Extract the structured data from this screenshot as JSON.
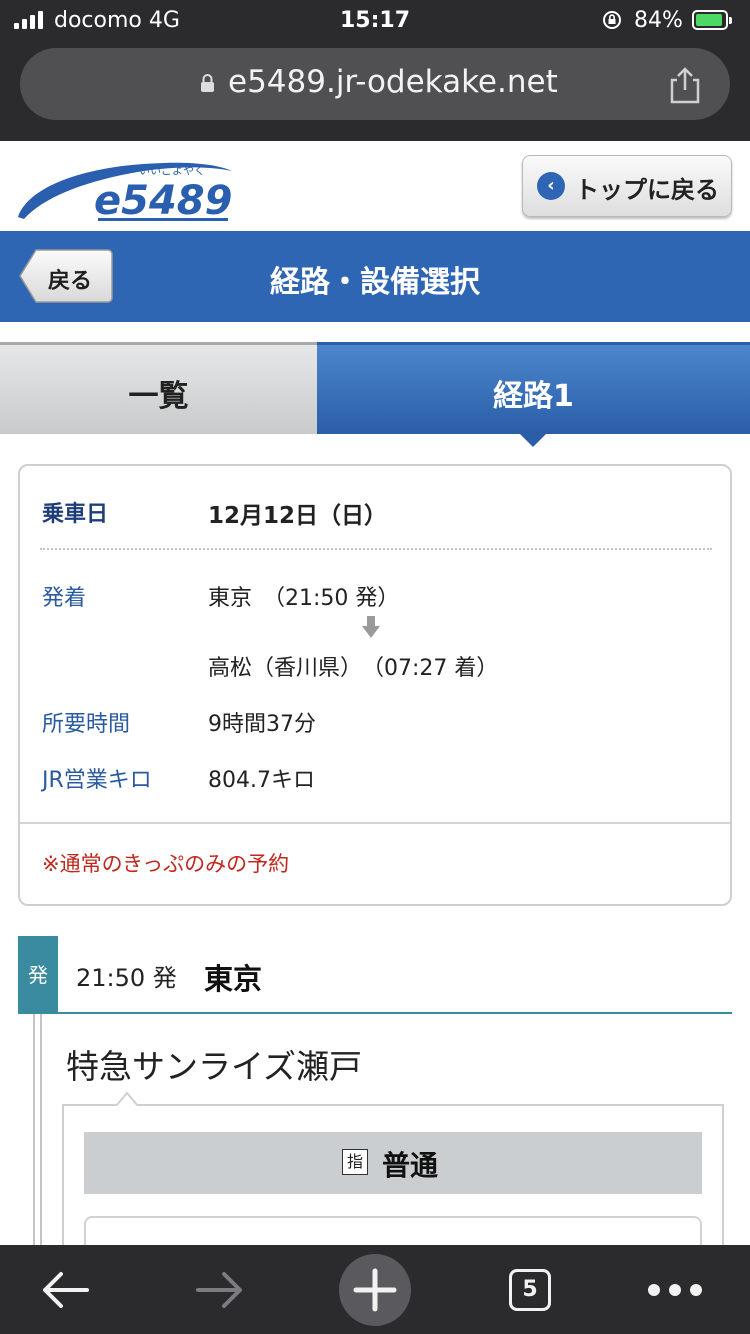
{
  "status_bar": {
    "carrier": "docomo   4G",
    "time": "15:17",
    "battery": "84%"
  },
  "browser": {
    "url": "e5489.jr-odekake.net",
    "open_tabs": "5"
  },
  "header": {
    "logo_text": "e5489",
    "logo_ruby": "いいごよやく",
    "top_button": "トップに戻る"
  },
  "title_bar": {
    "back_label": "戻る",
    "title": "経路・設備選択"
  },
  "tabs": [
    {
      "label": "一覧"
    },
    {
      "label": "経路1"
    }
  ],
  "summary": {
    "date_label": "乗車日",
    "date_value": "12月12日（日）",
    "depart_arrive_label": "発着",
    "from": "東京　（21:50 発）",
    "to": "高松（香川県）　（07:27 着）",
    "duration_label": "所要時間",
    "duration_value": "9時間37分",
    "distance_label": "JR営業キロ",
    "distance_value": "804.7キロ",
    "note": "※通常のきっぷのみの予約"
  },
  "departure": {
    "badge": "発",
    "time": "21:50 発",
    "station": "東京"
  },
  "train": {
    "name": "特急サンライズ瀬戸",
    "reserved_mark": "指",
    "seat_class": "普通"
  },
  "colors": {
    "brand_blue": "#2f66b4",
    "teal": "#3a8aa0",
    "note_red": "#c0281e"
  }
}
